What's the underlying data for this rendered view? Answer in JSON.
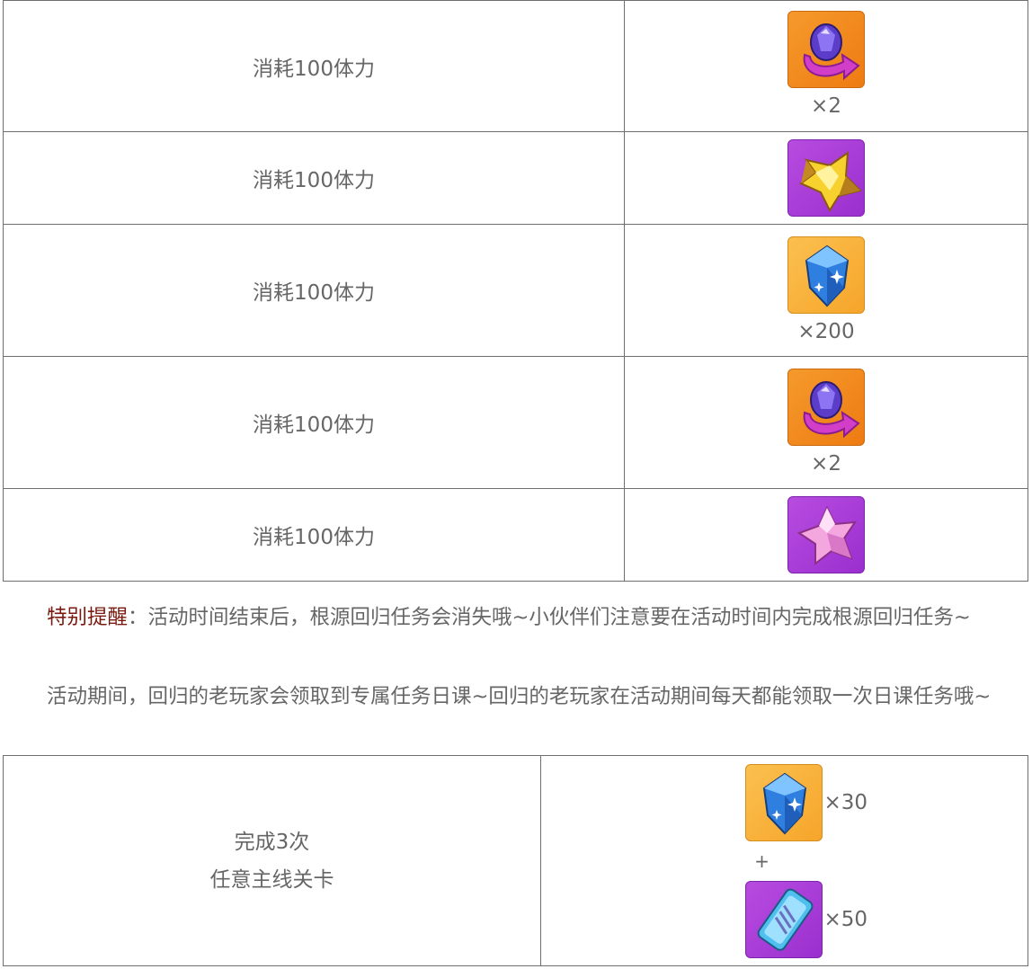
{
  "rewards_table": {
    "rows": [
      {
        "cost": "消耗100体力",
        "icon": "purple-gem-exchange-icon",
        "qty": "×2"
      },
      {
        "cost": "消耗100体力",
        "icon": "gold-star-icon",
        "qty": ""
      },
      {
        "cost": "消耗100体力",
        "icon": "blue-diamond-icon",
        "qty": "×200"
      },
      {
        "cost": "消耗100体力",
        "icon": "purple-gem-exchange-icon",
        "qty": "×2"
      },
      {
        "cost": "消耗100体力",
        "icon": "pink-star-crystal-icon",
        "qty": ""
      }
    ]
  },
  "notes": {
    "reminder_label": "特别提醒",
    "reminder_text": "：活动时间结束后，根源回归任务会消失哦~小伙伴们注意要在活动时间内完成根源回归任务~",
    "daily_text": "活动期间，回归的老玩家会领取到专属任务日课~回归的老玩家在活动期间每天都能领取一次日课任务哦~"
  },
  "task_table": {
    "task_line1": "完成3次",
    "task_line2": "任意主线关卡",
    "reward1_qty": "×30",
    "plus": "+",
    "reward2_qty": "×50"
  },
  "colors": {
    "border": "#6f6f6f",
    "text": "#666666",
    "highlight": "#7a1a0e",
    "icon_orange": "#ee7b12",
    "icon_yellow": "#f6a52a",
    "icon_purple": "#9a2fcf"
  }
}
